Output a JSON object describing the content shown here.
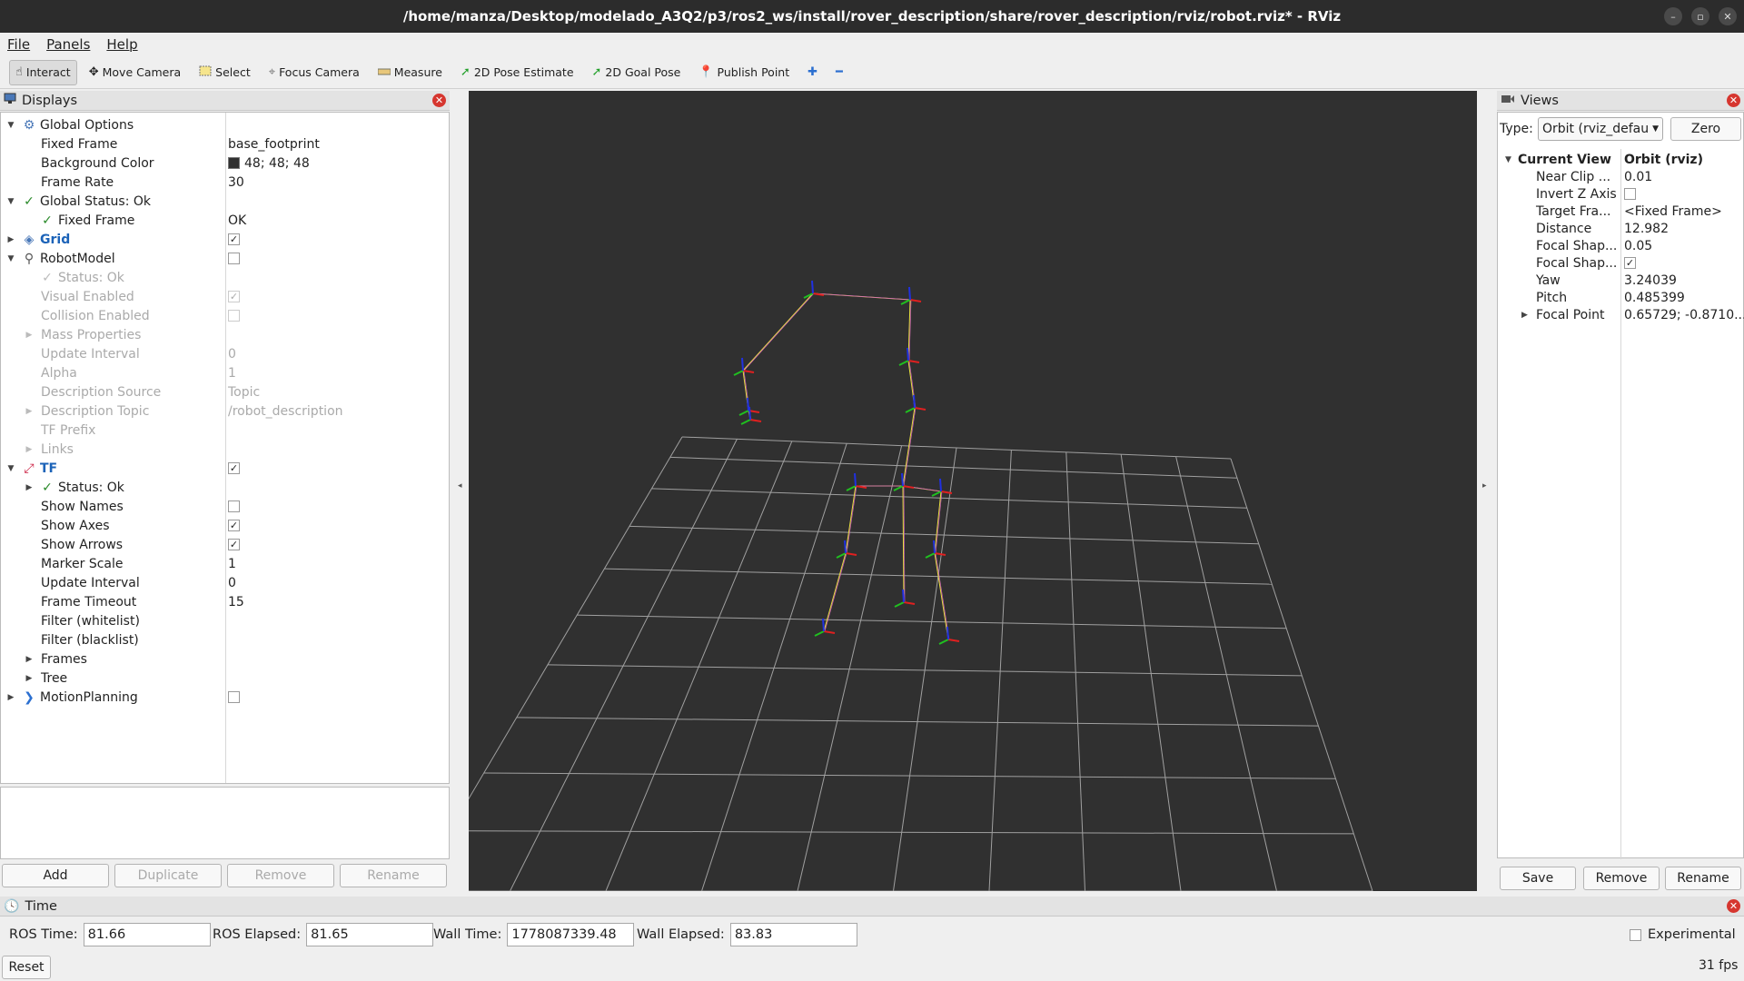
{
  "window": {
    "title": "/home/manza/Desktop/modelado_A3Q2/p3/ros2_ws/install/rover_description/share/rover_description/rviz/robot.rviz* - RViz"
  },
  "menu": [
    "File",
    "Panels",
    "Help"
  ],
  "toolbar": {
    "interact": "Interact",
    "move_camera": "Move Camera",
    "select": "Select",
    "focus_camera": "Focus Camera",
    "measure": "Measure",
    "pose_estimate": "2D Pose Estimate",
    "goal_pose": "2D Goal Pose",
    "publish_point": "Publish Point"
  },
  "displays": {
    "title": "Displays",
    "rows": [
      {
        "name": "Global Options",
        "arrow": "down",
        "icon": "gear-icon",
        "indent": 0
      },
      {
        "name": "Fixed Frame",
        "value": "base_footprint",
        "indent": 1
      },
      {
        "name": "Background Color",
        "value": "48; 48; 48",
        "swatch": "#303030",
        "indent": 1
      },
      {
        "name": "Frame Rate",
        "value": "30",
        "indent": 1
      },
      {
        "name": "Global Status: Ok",
        "arrow": "down",
        "icon": "check-icon",
        "indent": 0
      },
      {
        "name": "Fixed Frame",
        "value": "OK",
        "icon": "check-icon",
        "indent": 1
      },
      {
        "name": "Grid",
        "arrow": "right",
        "icon": "grid-icon",
        "checkbox": true,
        "bold": true,
        "indent": 0
      },
      {
        "name": "RobotModel",
        "arrow": "down",
        "icon": "robot-icon",
        "checkbox": false,
        "indent": 0
      },
      {
        "name": "Status: Ok",
        "icon": "check-icon",
        "indent": 1,
        "disabled": true
      },
      {
        "name": "Visual Enabled",
        "checkbox": true,
        "indent": 1,
        "disabled": true
      },
      {
        "name": "Collision Enabled",
        "checkbox": false,
        "indent": 1,
        "disabled": true
      },
      {
        "name": "Mass Properties",
        "arrow": "right",
        "indent": 1,
        "disabled": true
      },
      {
        "name": "Update Interval",
        "value": "0",
        "indent": 1,
        "disabled": true
      },
      {
        "name": "Alpha",
        "value": "1",
        "indent": 1,
        "disabled": true
      },
      {
        "name": "Description Source",
        "value": "Topic",
        "indent": 1,
        "disabled": true
      },
      {
        "name": "Description Topic",
        "value": "/robot_description",
        "arrow": "right",
        "indent": 1,
        "disabled": true
      },
      {
        "name": "TF Prefix",
        "indent": 1,
        "disabled": true
      },
      {
        "name": "Links",
        "arrow": "right",
        "indent": 1,
        "disabled": true
      },
      {
        "name": "TF",
        "arrow": "down",
        "icon": "tf-icon",
        "checkbox": true,
        "bold": true,
        "indent": 0
      },
      {
        "name": "Status: Ok",
        "arrow": "right",
        "icon": "check-icon",
        "indent": 1
      },
      {
        "name": "Show Names",
        "checkbox": false,
        "indent": 1
      },
      {
        "name": "Show Axes",
        "checkbox": true,
        "indent": 1
      },
      {
        "name": "Show Arrows",
        "checkbox": true,
        "indent": 1
      },
      {
        "name": "Marker Scale",
        "value": "1",
        "indent": 1
      },
      {
        "name": "Update Interval",
        "value": "0",
        "indent": 1
      },
      {
        "name": "Frame Timeout",
        "value": "15",
        "indent": 1
      },
      {
        "name": "Filter (whitelist)",
        "indent": 1
      },
      {
        "name": "Filter (blacklist)",
        "indent": 1
      },
      {
        "name": "Frames",
        "arrow": "right",
        "indent": 1
      },
      {
        "name": "Tree",
        "arrow": "right",
        "indent": 1
      },
      {
        "name": "MotionPlanning",
        "arrow": "right",
        "icon": "plugin-icon",
        "checkbox": false,
        "indent": 0
      }
    ],
    "buttons": {
      "add": "Add",
      "duplicate": "Duplicate",
      "remove": "Remove",
      "rename": "Rename"
    }
  },
  "views": {
    "title": "Views",
    "type_label": "Type:",
    "type_value": "Orbit (rviz_defau",
    "zero": "Zero",
    "rows": [
      {
        "name": "Current View",
        "value": "Orbit (rviz)",
        "bold": true,
        "arrow": "down"
      },
      {
        "name": "Near Clip ...",
        "value": "0.01"
      },
      {
        "name": "Invert Z Axis",
        "checkbox": false
      },
      {
        "name": "Target Fra...",
        "value": "<Fixed Frame>"
      },
      {
        "name": "Distance",
        "value": "12.982"
      },
      {
        "name": "Focal Shap...",
        "value": "0.05"
      },
      {
        "name": "Focal Shap...",
        "checkbox": true
      },
      {
        "name": "Yaw",
        "value": "3.24039"
      },
      {
        "name": "Pitch",
        "value": "0.485399"
      },
      {
        "name": "Focal Point",
        "value": "0.65729; -0.8710...",
        "arrow": "right"
      }
    ],
    "buttons": {
      "save": "Save",
      "remove": "Remove",
      "rename": "Rename"
    }
  },
  "time": {
    "title": "Time",
    "ros_time_label": "ROS Time:",
    "ros_time": "81.66",
    "ros_elapsed_label": "ROS Elapsed:",
    "ros_elapsed": "81.65",
    "wall_time_label": "Wall Time:",
    "wall_time": "1778087339.48",
    "wall_elapsed_label": "Wall Elapsed:",
    "wall_elapsed": "83.83",
    "experimental": "Experimental",
    "reset": "Reset",
    "fps": "31 fps"
  }
}
